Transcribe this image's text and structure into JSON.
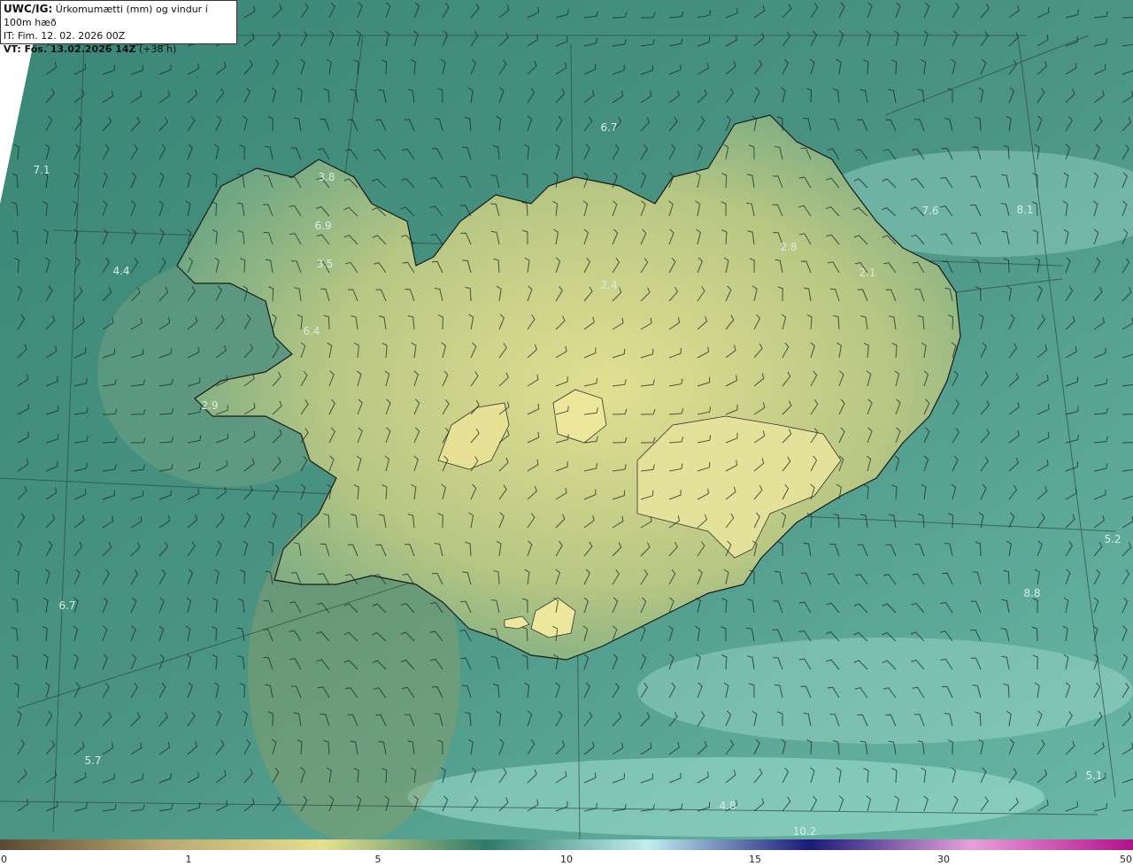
{
  "title": {
    "prefix": "UWC/IG:",
    "text": "Úrkomumætti (mm) og vindur í 100m hæð",
    "issue_time": "IT: Fim. 12. 02. 2026 00Z",
    "valid_prefix": "VT: Fös. 13.02.2026 14Z",
    "valid_suffix": "(+38 h)"
  },
  "point_labels": [
    {
      "text": "6.7"
    },
    {
      "text": "7.1"
    },
    {
      "text": "3.8"
    },
    {
      "text": "6.9"
    },
    {
      "text": "3.5"
    },
    {
      "text": "4.4"
    },
    {
      "text": "6.4"
    },
    {
      "text": "7.6"
    },
    {
      "text": "8.1"
    },
    {
      "text": "2.8"
    },
    {
      "text": "2.1"
    },
    {
      "text": "2.4"
    },
    {
      "text": "2.9"
    },
    {
      "text": "5.2"
    },
    {
      "text": "8.8"
    },
    {
      "text": "6.7"
    },
    {
      "text": "5.7"
    },
    {
      "text": "5.1"
    },
    {
      "text": "4.8"
    },
    {
      "text": "10.2"
    }
  ],
  "colorbar": {
    "ticks": [
      "0",
      "1",
      "5",
      "10",
      "15",
      "30",
      "50"
    ],
    "colors": [
      "#5a4a35",
      "#b9a870",
      "#e6e08c",
      "#2f7a6a",
      "#bfeeee",
      "#1a1a7a",
      "#e6a0d8",
      "#b4108c"
    ]
  },
  "colors": {
    "sea": "#3f8a78",
    "land": "#cdd690",
    "coast": "#1a1a1a"
  }
}
